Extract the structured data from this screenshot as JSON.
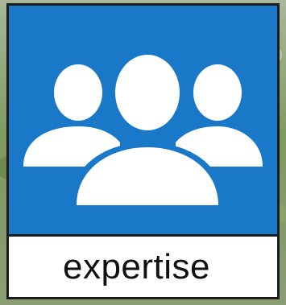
{
  "tile": {
    "label": "expertise",
    "icon": "team-group-icon",
    "icon_color": "#ffffff",
    "panel_color": "#1a78c8",
    "label_background": "#ffffff",
    "border_color": "#1c1c1c"
  }
}
